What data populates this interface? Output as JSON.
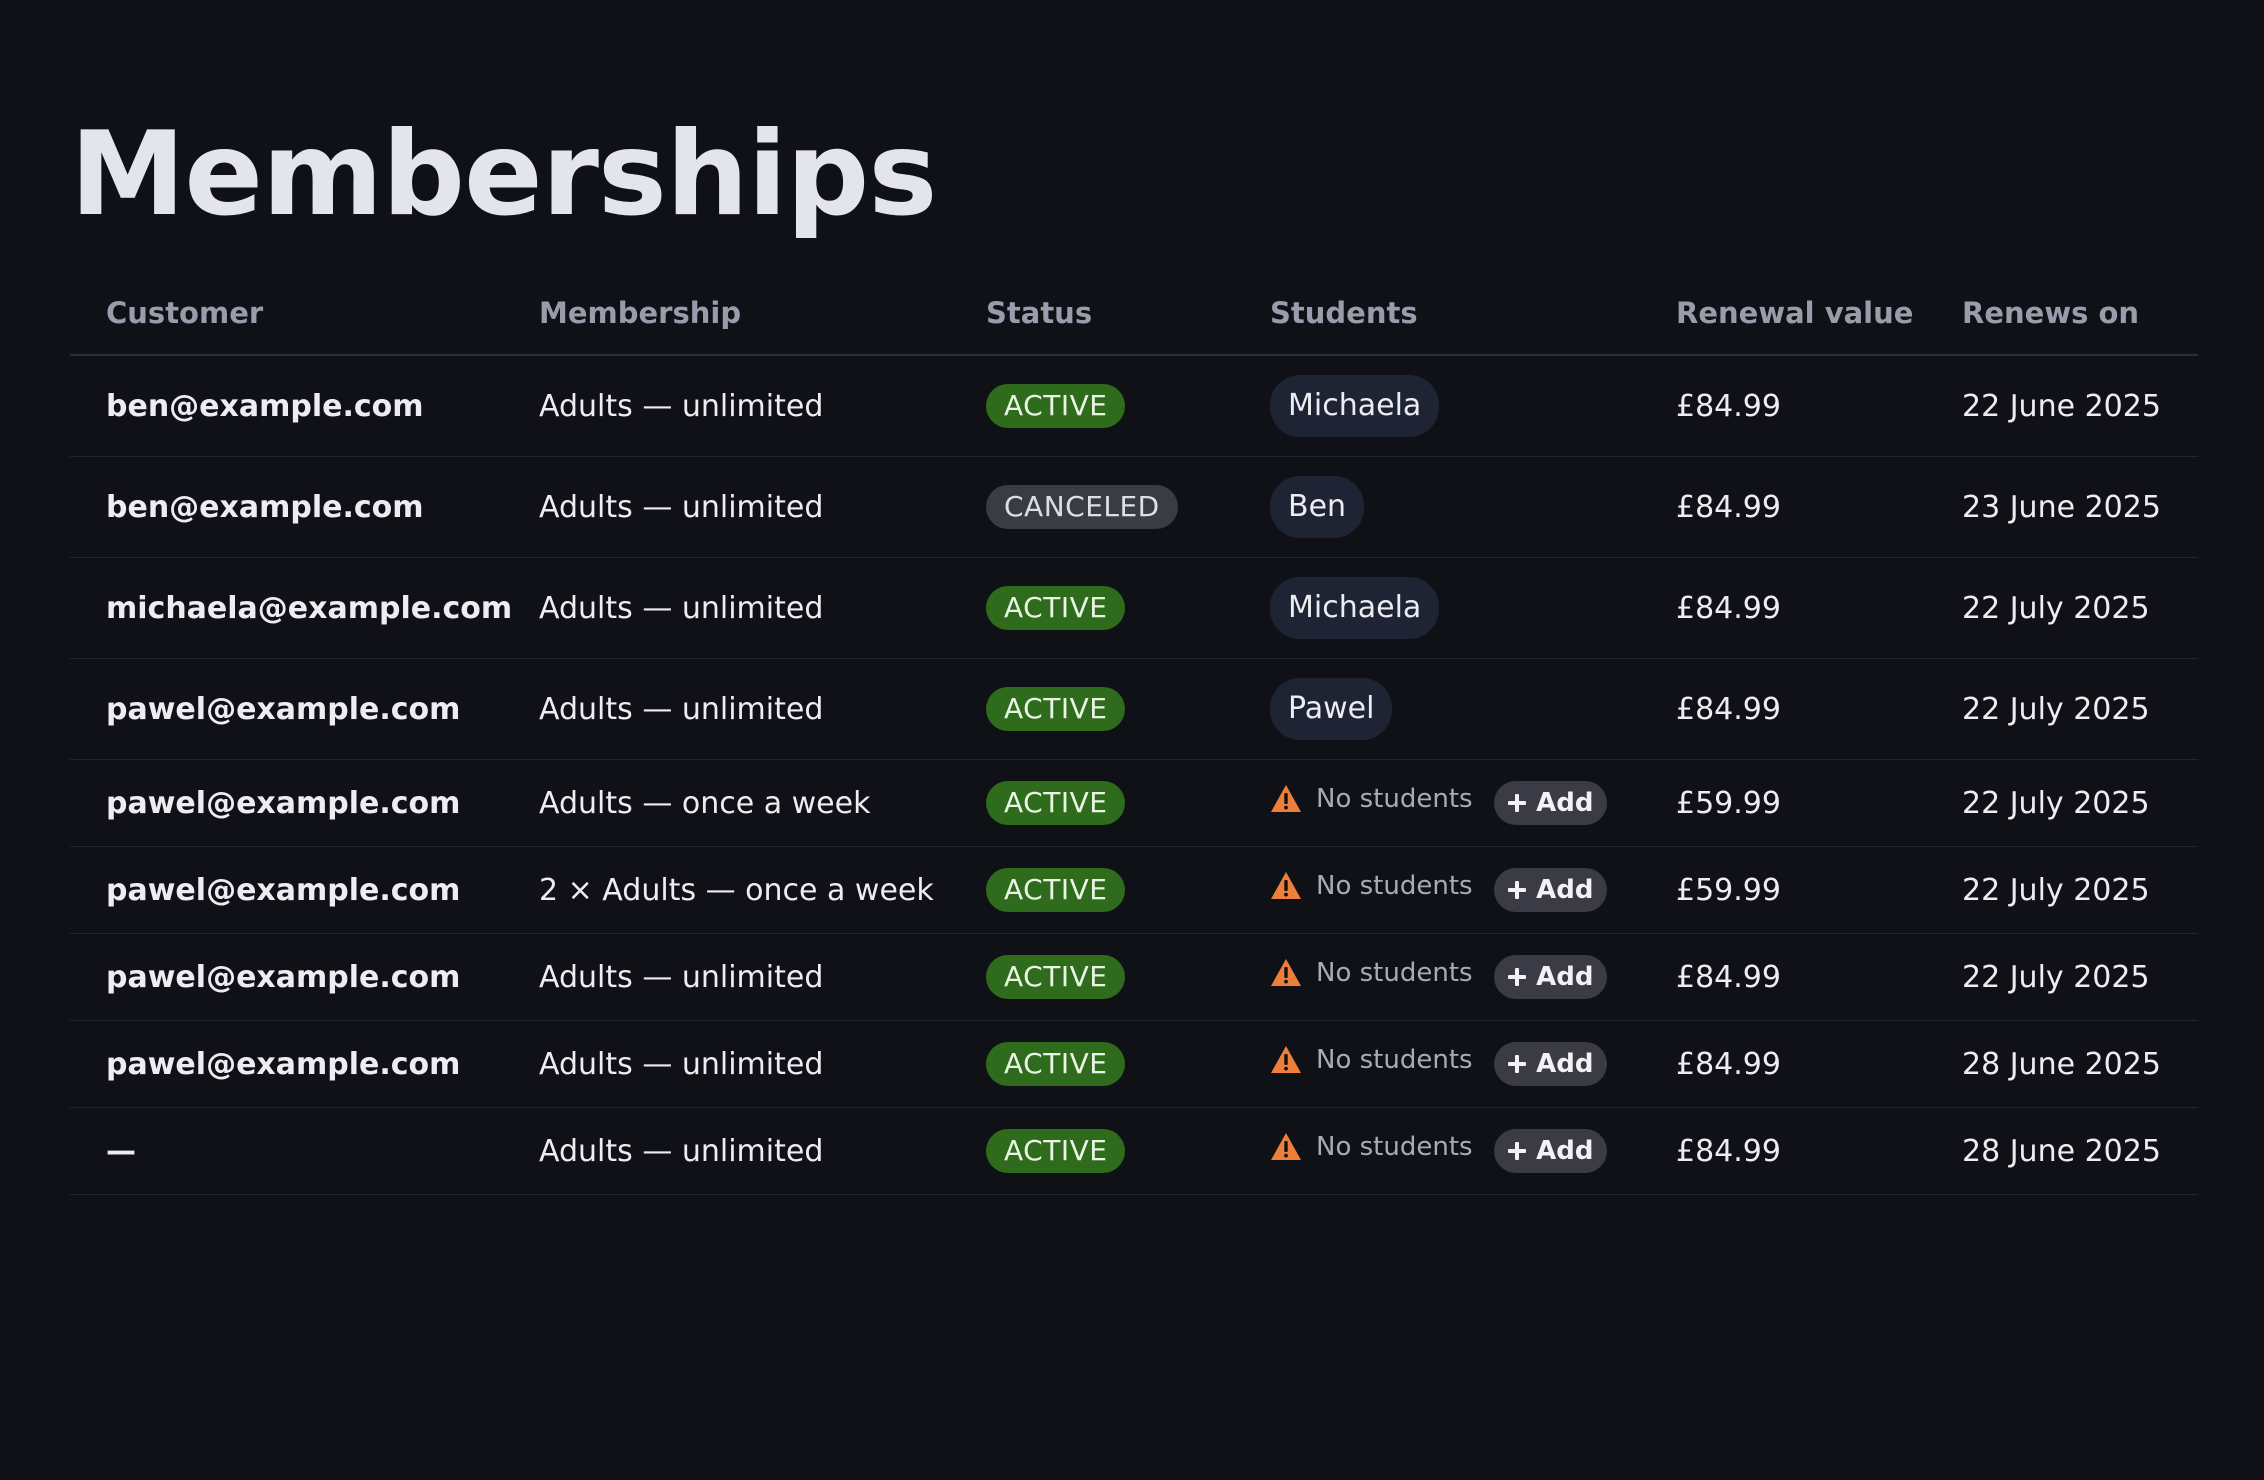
{
  "page": {
    "title": "Memberships"
  },
  "table": {
    "columns": [
      "Customer",
      "Membership",
      "Status",
      "Students",
      "Renewal value",
      "Renews on"
    ],
    "rows": [
      {
        "customer": "ben@example.com",
        "membership": "Adults — unlimited",
        "status": "ACTIVE",
        "student": "Michaela",
        "renewal": "£84.99",
        "renews": "22 June 2025"
      },
      {
        "customer": "ben@example.com",
        "membership": "Adults — unlimited",
        "status": "CANCELED",
        "student": "Ben",
        "renewal": "£84.99",
        "renews": "23 June 2025"
      },
      {
        "customer": "michaela@example.com",
        "membership": "Adults — unlimited",
        "status": "ACTIVE",
        "student": "Michaela",
        "renewal": "£84.99",
        "renews": "22 July 2025"
      },
      {
        "customer": "pawel@example.com",
        "membership": "Adults — unlimited",
        "status": "ACTIVE",
        "student": "Pawel",
        "renewal": "£84.99",
        "renews": "22 July 2025"
      },
      {
        "customer": "pawel@example.com",
        "membership": "Adults — once a week",
        "status": "ACTIVE",
        "no_students": "No students",
        "add_label": "Add",
        "renewal": "£59.99",
        "renews": "22 July 2025"
      },
      {
        "customer": "pawel@example.com",
        "membership": "2 × Adults — once a week",
        "status": "ACTIVE",
        "no_students": "No students",
        "add_label": "Add",
        "renewal": "£59.99",
        "renews": "22 July 2025"
      },
      {
        "customer": "pawel@example.com",
        "membership": "Adults — unlimited",
        "status": "ACTIVE",
        "no_students": "No students",
        "add_label": "Add",
        "renewal": "£84.99",
        "renews": "22 July 2025"
      },
      {
        "customer": "pawel@example.com",
        "membership": "Adults — unlimited",
        "status": "ACTIVE",
        "no_students": "No students",
        "add_label": "Add",
        "renewal": "£84.99",
        "renews": "28 June 2025"
      },
      {
        "customer": "—",
        "membership": "Adults — unlimited",
        "status": "ACTIVE",
        "no_students": "No students",
        "add_label": "Add",
        "renewal": "£84.99",
        "renews": "28 June 2025"
      }
    ]
  },
  "icons": {
    "warning": "warning-triangle-icon",
    "add": "plus-icon"
  },
  "colors": {
    "background": "#101117",
    "active_badge": "#2e6b1c",
    "canceled_badge": "#3a3b44",
    "student_chip": "#1e2433",
    "warning": "#ee7f3a"
  }
}
